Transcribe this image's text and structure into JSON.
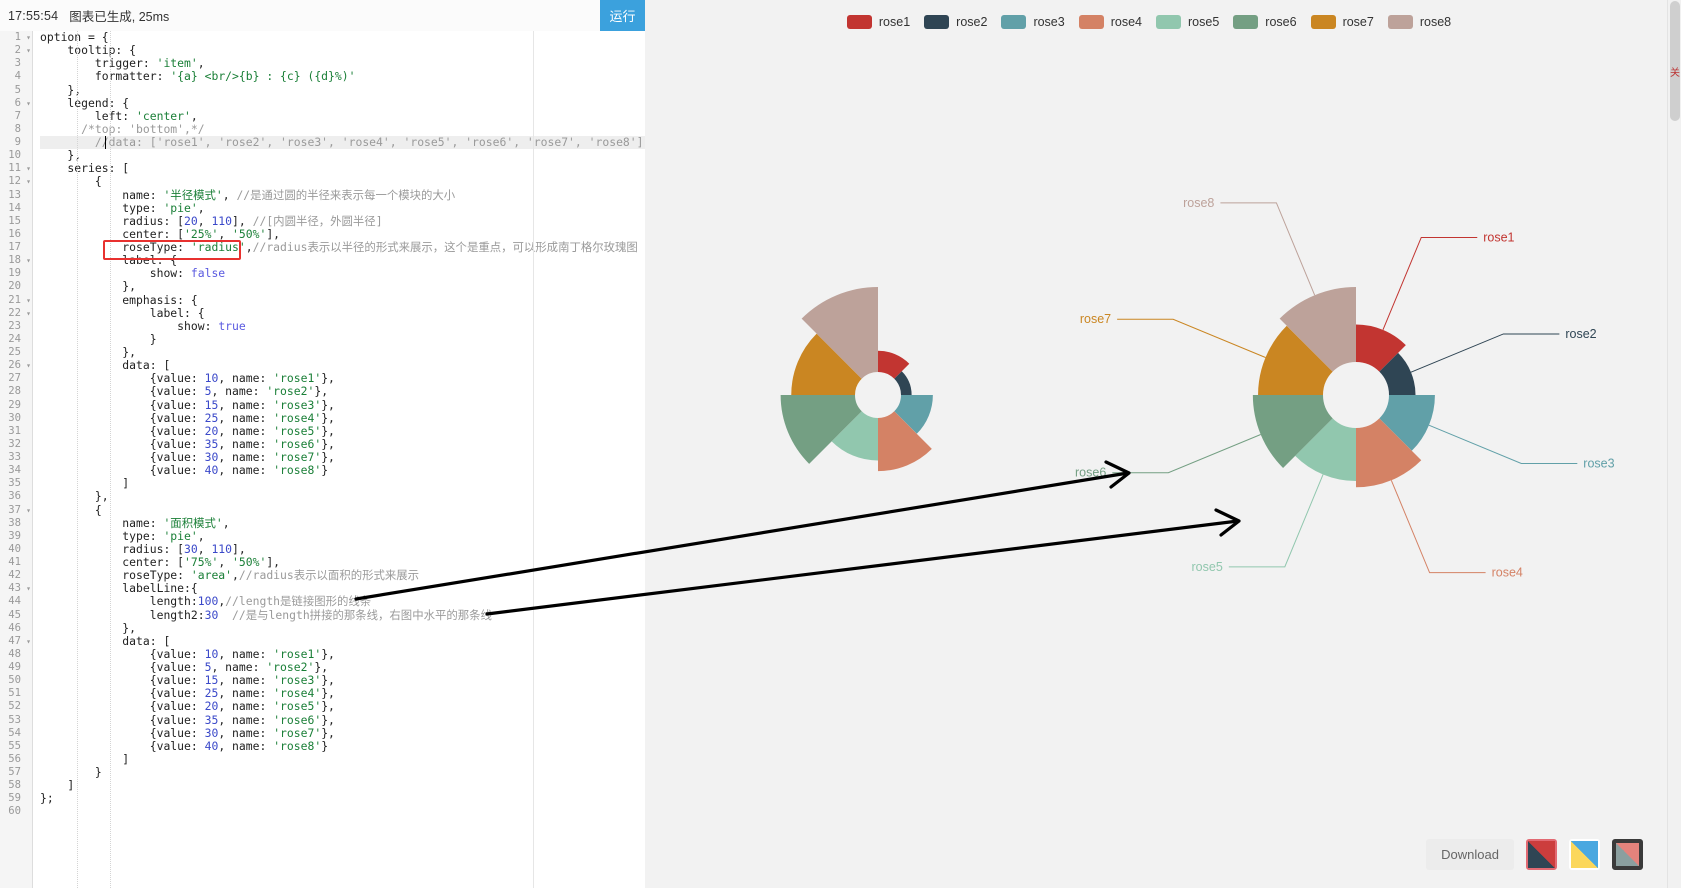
{
  "statusbar": {
    "time": "17:55:54",
    "message": "图表已生成, 25ms",
    "run_label": "运行"
  },
  "editor": {
    "total_lines": 60,
    "highlighted_line": 9,
    "red_box_line": 17,
    "red_box_text": "roseType: 'radius',",
    "lines": [
      {
        "n": 1,
        "fold": true,
        "text": "option = {"
      },
      {
        "n": 2,
        "fold": true,
        "text": "    tooltip: {"
      },
      {
        "n": 3,
        "fold": false,
        "text": "        trigger: 'item',"
      },
      {
        "n": 4,
        "fold": false,
        "text": "        formatter: '{a} <br/>{b} : {c} ({d}%)'"
      },
      {
        "n": 5,
        "fold": false,
        "text": "    },"
      },
      {
        "n": 6,
        "fold": true,
        "text": "    legend: {"
      },
      {
        "n": 7,
        "fold": false,
        "text": "        left: 'center',"
      },
      {
        "n": 8,
        "fold": false,
        "text": "      /*top: 'bottom',*/"
      },
      {
        "n": 9,
        "fold": false,
        "text": "        //data: ['rose1', 'rose2', 'rose3', 'rose4', 'rose5', 'rose6', 'rose7', 'rose8']"
      },
      {
        "n": 10,
        "fold": false,
        "text": "    },"
      },
      {
        "n": 11,
        "fold": true,
        "text": "    series: ["
      },
      {
        "n": 12,
        "fold": true,
        "text": "        {"
      },
      {
        "n": 13,
        "fold": false,
        "text": "            name: '半径模式', //是通过圆的半径来表示每一个模块的大小"
      },
      {
        "n": 14,
        "fold": false,
        "text": "            type: 'pie',"
      },
      {
        "n": 15,
        "fold": false,
        "text": "            radius: [20, 110], //[内圆半径，外圆半径]"
      },
      {
        "n": 16,
        "fold": false,
        "text": "            center: ['25%', '50%'],"
      },
      {
        "n": 17,
        "fold": false,
        "text": "            roseType: 'radius',//radius表示以半径的形式来展示，这个是重点，可以形成南丁格尔玫瑰图"
      },
      {
        "n": 18,
        "fold": true,
        "text": "            label: {"
      },
      {
        "n": 19,
        "fold": false,
        "text": "                show: false"
      },
      {
        "n": 20,
        "fold": false,
        "text": "            },"
      },
      {
        "n": 21,
        "fold": true,
        "text": "            emphasis: {"
      },
      {
        "n": 22,
        "fold": true,
        "text": "                label: {"
      },
      {
        "n": 23,
        "fold": false,
        "text": "                    show: true"
      },
      {
        "n": 24,
        "fold": false,
        "text": "                }"
      },
      {
        "n": 25,
        "fold": false,
        "text": "            },"
      },
      {
        "n": 26,
        "fold": true,
        "text": "            data: ["
      },
      {
        "n": 27,
        "fold": false,
        "text": "                {value: 10, name: 'rose1'},"
      },
      {
        "n": 28,
        "fold": false,
        "text": "                {value: 5, name: 'rose2'},"
      },
      {
        "n": 29,
        "fold": false,
        "text": "                {value: 15, name: 'rose3'},"
      },
      {
        "n": 30,
        "fold": false,
        "text": "                {value: 25, name: 'rose4'},"
      },
      {
        "n": 31,
        "fold": false,
        "text": "                {value: 20, name: 'rose5'},"
      },
      {
        "n": 32,
        "fold": false,
        "text": "                {value: 35, name: 'rose6'},"
      },
      {
        "n": 33,
        "fold": false,
        "text": "                {value: 30, name: 'rose7'},"
      },
      {
        "n": 34,
        "fold": false,
        "text": "                {value: 40, name: 'rose8'}"
      },
      {
        "n": 35,
        "fold": false,
        "text": "            ]"
      },
      {
        "n": 36,
        "fold": false,
        "text": "        },"
      },
      {
        "n": 37,
        "fold": true,
        "text": "        {"
      },
      {
        "n": 38,
        "fold": false,
        "text": "            name: '面积模式',"
      },
      {
        "n": 39,
        "fold": false,
        "text": "            type: 'pie',"
      },
      {
        "n": 40,
        "fold": false,
        "text": "            radius: [30, 110],"
      },
      {
        "n": 41,
        "fold": false,
        "text": "            center: ['75%', '50%'],"
      },
      {
        "n": 42,
        "fold": false,
        "text": "            roseType: 'area',//radius表示以面积的形式来展示"
      },
      {
        "n": 43,
        "fold": true,
        "text": "            labelLine:{"
      },
      {
        "n": 44,
        "fold": false,
        "text": "                length:100,//length是链接图形的线条"
      },
      {
        "n": 45,
        "fold": false,
        "text": "                length2:30  //是与length拼接的那条线，右图中水平的那条线"
      },
      {
        "n": 46,
        "fold": false,
        "text": "            },"
      },
      {
        "n": 47,
        "fold": true,
        "text": "            data: ["
      },
      {
        "n": 48,
        "fold": false,
        "text": "                {value: 10, name: 'rose1'},"
      },
      {
        "n": 49,
        "fold": false,
        "text": "                {value: 5, name: 'rose2'},"
      },
      {
        "n": 50,
        "fold": false,
        "text": "                {value: 15, name: 'rose3'},"
      },
      {
        "n": 51,
        "fold": false,
        "text": "                {value: 25, name: 'rose4'},"
      },
      {
        "n": 52,
        "fold": false,
        "text": "                {value: 20, name: 'rose5'},"
      },
      {
        "n": 53,
        "fold": false,
        "text": "                {value: 35, name: 'rose6'},"
      },
      {
        "n": 54,
        "fold": false,
        "text": "                {value: 30, name: 'rose7'},"
      },
      {
        "n": 55,
        "fold": false,
        "text": "                {value: 40, name: 'rose8'}"
      },
      {
        "n": 56,
        "fold": false,
        "text": "            ]"
      },
      {
        "n": 57,
        "fold": false,
        "text": "        }"
      },
      {
        "n": 58,
        "fold": false,
        "text": "    ]"
      },
      {
        "n": 59,
        "fold": false,
        "text": "};"
      },
      {
        "n": 60,
        "fold": false,
        "text": ""
      }
    ]
  },
  "chart_data": {
    "type": "pie",
    "title": "",
    "legend_position": "top-center",
    "palette": [
      "#c23531",
      "#2f4554",
      "#61a0a8",
      "#d48265",
      "#91c7ae",
      "#749f83",
      "#ca8622",
      "#bda29a"
    ],
    "legend": [
      "rose1",
      "rose2",
      "rose3",
      "rose4",
      "rose5",
      "rose6",
      "rose7",
      "rose8"
    ],
    "categories": [
      "rose1",
      "rose2",
      "rose3",
      "rose4",
      "rose5",
      "rose6",
      "rose7",
      "rose8"
    ],
    "series": [
      {
        "name": "半径模式",
        "roseType": "radius",
        "radius": [
          20,
          110
        ],
        "center": [
          "25%",
          "50%"
        ],
        "labels_shown": false,
        "values": [
          10,
          5,
          15,
          25,
          20,
          35,
          30,
          40
        ]
      },
      {
        "name": "面积模式",
        "roseType": "area",
        "radius": [
          30,
          110
        ],
        "center": [
          "75%",
          "50%"
        ],
        "labels_shown": true,
        "labelLine": {
          "length": 100,
          "length2": 30
        },
        "values": [
          10,
          5,
          15,
          25,
          20,
          35,
          30,
          40
        ]
      }
    ],
    "visible_labels": [
      "rose8",
      "rose1",
      "rose7",
      "rose6",
      "rose5",
      "rose4"
    ]
  },
  "toolbar": {
    "download_label": "Download",
    "themes": [
      {
        "name": "theme-red-dark",
        "selected": true,
        "colors": [
          "#cc3d3d",
          "#2f4554"
        ]
      },
      {
        "name": "theme-blue-yellow",
        "selected": false,
        "colors": [
          "#4aa8e0",
          "#fbd75b"
        ]
      },
      {
        "name": "theme-dark",
        "selected": false,
        "colors": [
          "#e4837c",
          "#8b9f9f"
        ]
      }
    ]
  },
  "side_note": "关"
}
